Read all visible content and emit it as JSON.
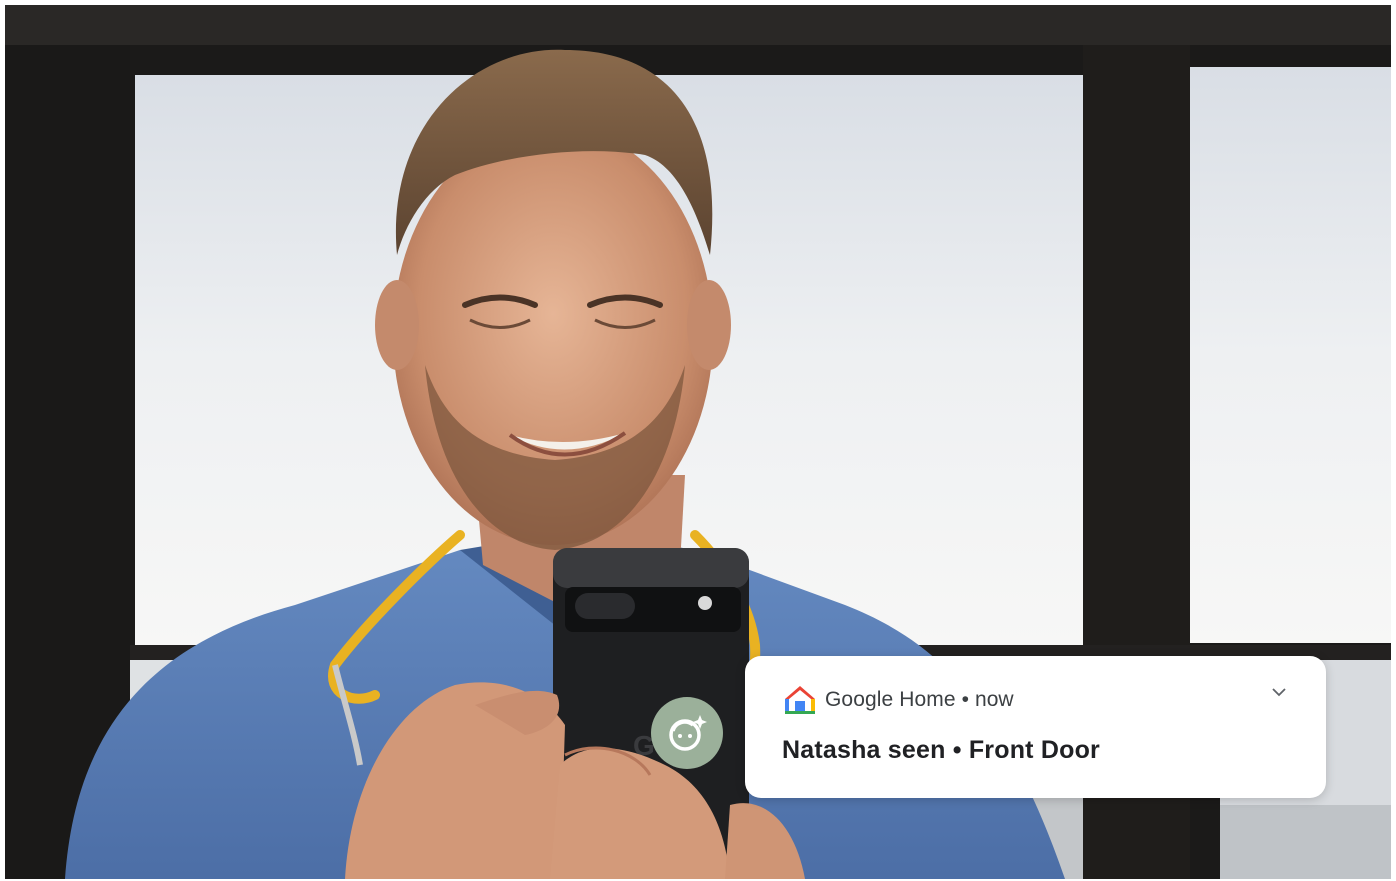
{
  "photo": {
    "description_icon": "person-holding-phone-photo"
  },
  "notification": {
    "app_name": "Google Home",
    "separator": "•",
    "time": "now",
    "title": "Natasha seen • Front Door",
    "icon": "google-home-icon",
    "expand_icon": "chevron-down-icon"
  },
  "badge": {
    "icon": "face-sparkle-icon",
    "color": "#9bb09a"
  },
  "colors": {
    "card_bg": "#ffffff",
    "scrub_blue": "#5b7eb6",
    "stethoscope_yellow": "#e9b222",
    "phone_black": "#1e1f21"
  }
}
